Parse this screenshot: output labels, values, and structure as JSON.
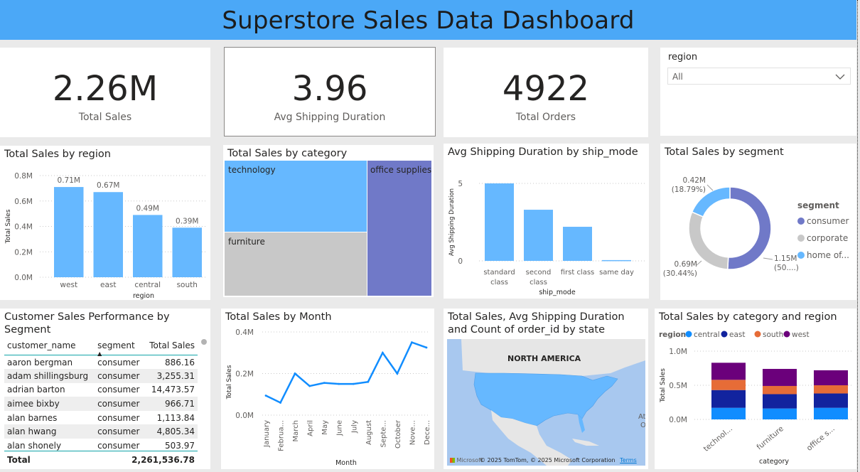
{
  "header": {
    "title": "Superstore Sales Data Dashboard"
  },
  "kpis": [
    {
      "value": "2.26M",
      "label": "Total Sales"
    },
    {
      "value": "3.96",
      "label": "Avg Shipping Duration"
    },
    {
      "value": "4922",
      "label": "Total Orders"
    }
  ],
  "slicer": {
    "label": "region",
    "value": "All"
  },
  "colors": {
    "accent": "#4ba8f7",
    "bar": "#66b8ff",
    "purple": "#7079c8",
    "gray": "#c8c8c8",
    "navy": "#12239e",
    "orange": "#e66c37",
    "violet": "#6b007b",
    "blue": "#118dff"
  },
  "charts": {
    "region": {
      "title": "Total Sales by region",
      "chart_data": {
        "type": "bar",
        "categories": [
          "west",
          "east",
          "central",
          "south"
        ],
        "values": [
          0.71,
          0.67,
          0.49,
          0.39
        ],
        "data_labels": [
          "0.71M",
          "0.67M",
          "0.49M",
          "0.39M"
        ],
        "ylabel": "Total Sales",
        "xlabel": "region",
        "ylim": [
          0,
          0.8
        ],
        "yticks": [
          "0.0M",
          "0.2M",
          "0.4M",
          "0.6M",
          "0.8M"
        ]
      }
    },
    "category": {
      "title": "Total Sales by category",
      "chart_data": {
        "type": "treemap",
        "items": [
          {
            "name": "technology"
          },
          {
            "name": "furniture"
          },
          {
            "name": "office supplies"
          }
        ]
      }
    },
    "ship": {
      "title": "Avg Shipping Duration by ship_mode",
      "chart_data": {
        "type": "bar",
        "categories": [
          "standard class",
          "second class",
          "first class",
          "same day"
        ],
        "values": [
          5.0,
          3.3,
          2.2,
          0.05
        ],
        "ylabel": "Avg Shipping Duration",
        "xlabel": "ship_mode",
        "ylim": [
          0,
          5
        ],
        "yticks": [
          "0",
          "5"
        ]
      }
    },
    "segment": {
      "title": "Total Sales by segment",
      "chart_data": {
        "type": "pie",
        "legend_title": "segment",
        "slices": [
          {
            "name": "consumer",
            "legend": "consumer",
            "value": 1.15,
            "pct": 50.77,
            "label1": "1.15M",
            "label2": "(50....)"
          },
          {
            "name": "corporate",
            "legend": "corporate",
            "value": 0.69,
            "pct": 30.44,
            "label1": "0.69M",
            "label2": "(30.44%)"
          },
          {
            "name": "home office",
            "legend": "home of...",
            "value": 0.42,
            "pct": 18.79,
            "label1": "0.42M",
            "label2": "(18.79%)"
          }
        ]
      }
    },
    "table": {
      "title": "Customer Sales Performance by Segment",
      "columns": [
        "customer_name",
        "segment",
        "Total Sales"
      ],
      "rows": [
        [
          "aaron bergman",
          "consumer",
          "886.16"
        ],
        [
          "adam shillingsburg",
          "consumer",
          "3,255.31"
        ],
        [
          "adrian barton",
          "consumer",
          "14,473.57"
        ],
        [
          "aimee bixby",
          "consumer",
          "966.71"
        ],
        [
          "alan barnes",
          "consumer",
          "1,113.84"
        ],
        [
          "alan hwang",
          "consumer",
          "4,805.34"
        ],
        [
          "alan shonely",
          "consumer",
          "503.97"
        ]
      ],
      "total_label": "Total",
      "total_value": "2,261,536.78"
    },
    "month": {
      "title": "Total Sales by Month",
      "chart_data": {
        "type": "line",
        "categories": [
          "January",
          "Februa...",
          "March",
          "April",
          "May",
          "June",
          "July",
          "August",
          "Septe...",
          "October",
          "Nove...",
          "Dece..."
        ],
        "values": [
          0.094,
          0.06,
          0.2,
          0.14,
          0.155,
          0.15,
          0.15,
          0.16,
          0.3,
          0.2,
          0.35,
          0.325
        ],
        "ylabel": "Total Sales",
        "xlabel": "Month",
        "ylim": [
          0,
          0.4
        ],
        "yticks": [
          "0.0M",
          "0.2M",
          "0.4M"
        ]
      }
    },
    "map": {
      "title": "Total Sales, Avg Shipping Duration and Count of order_id by state",
      "region_label": "NORTH AMERICA",
      "edge_label": "At\nO",
      "copyright": "© 2025 TomTom, © 2025 Microsoft Corporation",
      "terms": "Terms",
      "brand": "Microsoft"
    },
    "stacked": {
      "title": "Total Sales by category and region",
      "chart_data": {
        "type": "bar",
        "stacked": true,
        "legend_title": "region",
        "categories": [
          "technol...",
          "furniture",
          "office s..."
        ],
        "series": [
          {
            "name": "central",
            "values": [
              0.17,
              0.16,
              0.17
            ]
          },
          {
            "name": "east",
            "values": [
              0.26,
              0.21,
              0.21
            ]
          },
          {
            "name": "south",
            "values": [
              0.15,
              0.12,
              0.12
            ]
          },
          {
            "name": "west",
            "values": [
              0.25,
              0.25,
              0.22
            ]
          }
        ],
        "ylabel": "Total Sales",
        "xlabel": "category",
        "ylim": [
          0,
          1.0
        ],
        "yticks": [
          "0.0M",
          "0.5M",
          "1.0M"
        ]
      }
    }
  }
}
